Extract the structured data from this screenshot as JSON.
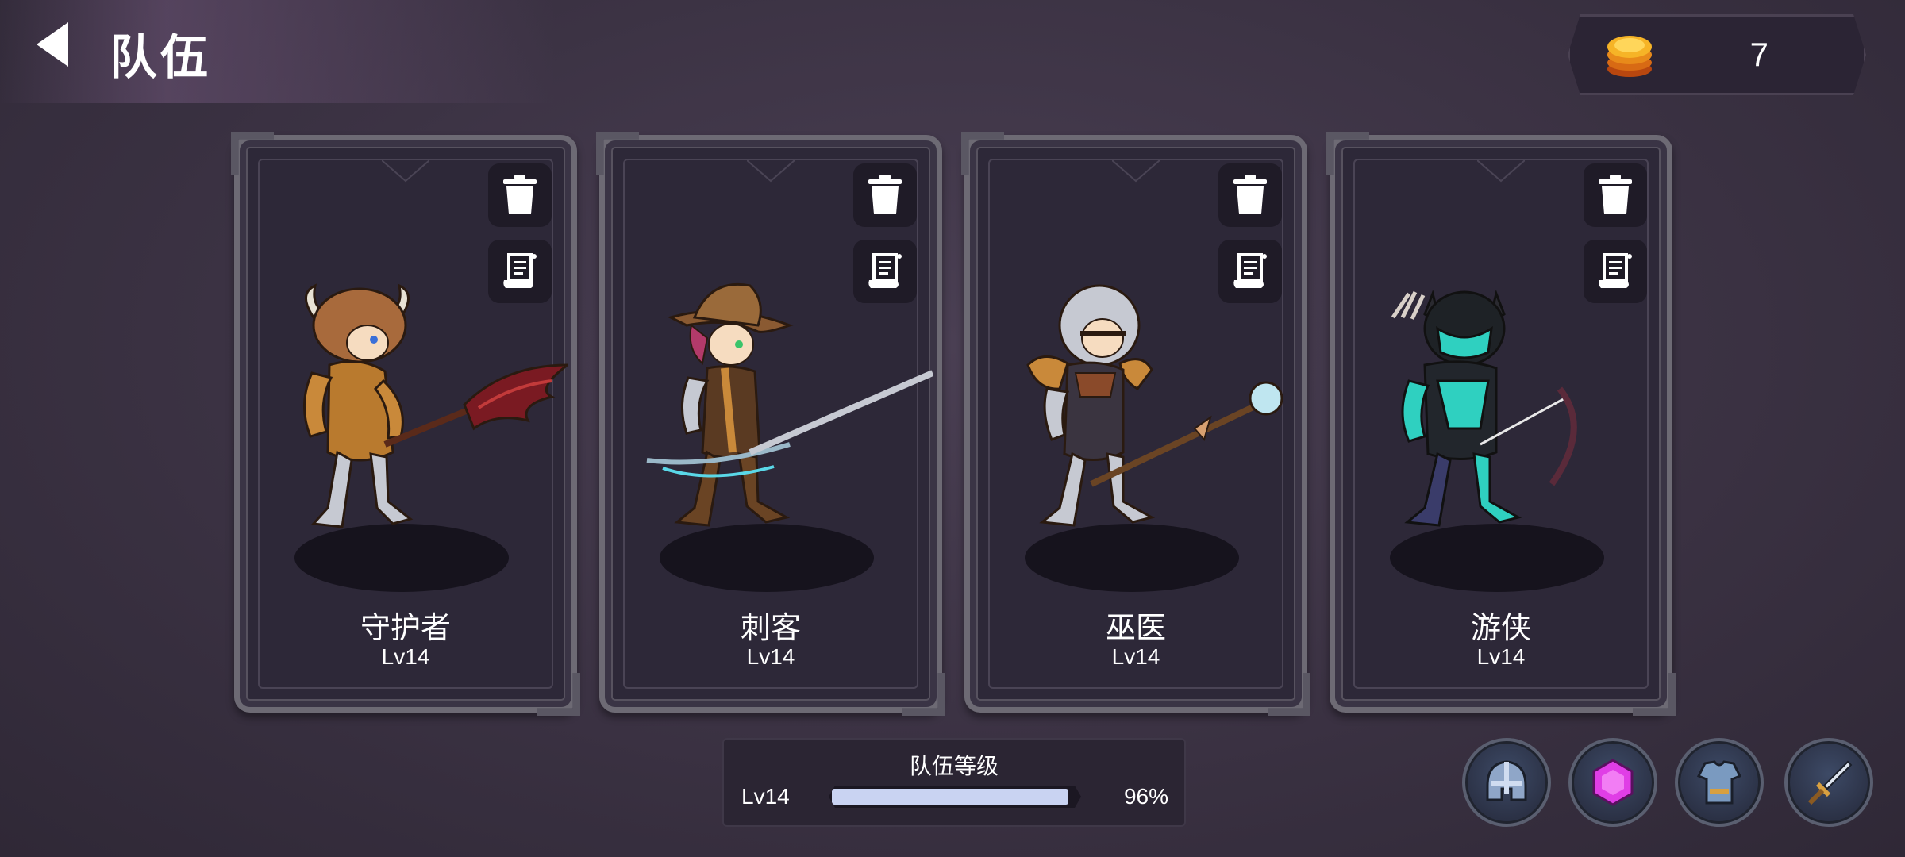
{
  "header": {
    "title": "队伍"
  },
  "currency": {
    "value": "7"
  },
  "heroes": [
    {
      "name": "守护者",
      "level": "Lv14"
    },
    {
      "name": "刺客",
      "level": "Lv14"
    },
    {
      "name": "巫医",
      "level": "Lv14"
    },
    {
      "name": "游侠",
      "level": "Lv14"
    }
  ],
  "team_level": {
    "title": "队伍等级",
    "level": "Lv14",
    "progress_percent": "96%",
    "progress_fraction": 0.96
  },
  "colors": {
    "progress_fill": "#c9d3f2",
    "coin": "#f2a21a",
    "gem": "#e03ee6"
  },
  "bottom_buttons": [
    "helmet-icon",
    "gem-icon",
    "armor-icon",
    "sword-icon"
  ]
}
